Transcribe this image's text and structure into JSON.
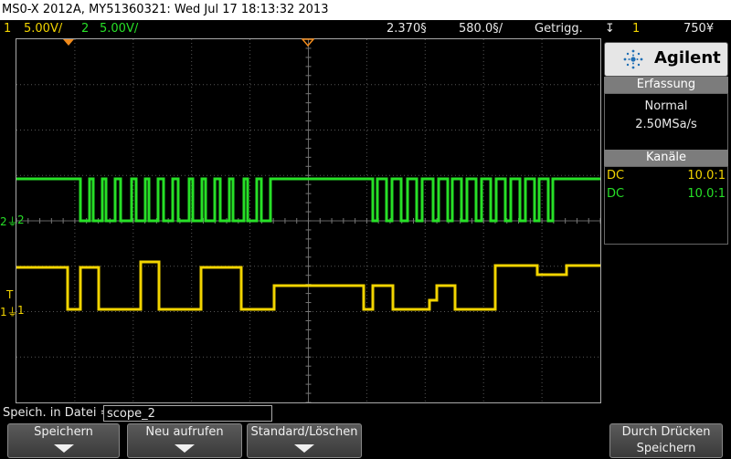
{
  "title": "MS0-X 2012A, MY51360321: Wed Jul 17 18:13:32 2013",
  "channel_bar": {
    "ch1_num": "1",
    "ch1_scale": "5.00V/",
    "ch2_num": "2",
    "ch2_scale": "5.00V/",
    "time_offset": "2.370§",
    "time_scale": "580.0§/",
    "trigger_mode": "Getrigg.",
    "trigger_icon": "trigger-edge-icon",
    "trigger_source": "1",
    "trigger_level": "750¥"
  },
  "side_panel": {
    "brand": "Agilent",
    "acquisition_header": "Erfassung",
    "acquisition_mode": "Normal",
    "sample_rate": "2.50MSa/s",
    "channels_header": "Kanäle",
    "channels": [
      {
        "coupling": "DC",
        "probe": "10.0:1",
        "color": "#f2d400"
      },
      {
        "coupling": "DC",
        "probe": "10.0:1",
        "color": "#27e027"
      }
    ]
  },
  "markers": {
    "ch2_label": "2",
    "ch1_label": "1",
    "trigger_label": "T"
  },
  "save": {
    "label": "Speich. in Datei =",
    "filename": "scope_2"
  },
  "softkeys": [
    {
      "label": "Speichern"
    },
    {
      "label": "Neu aufrufen"
    },
    {
      "label": "Standard/Löschen"
    },
    {
      "label_line1": "Durch Drücken",
      "label_line2": "Speichern"
    }
  ],
  "colors": {
    "ch1": "#f2d400",
    "ch2": "#27e027",
    "trigger_marker": "#f08a1c"
  }
}
